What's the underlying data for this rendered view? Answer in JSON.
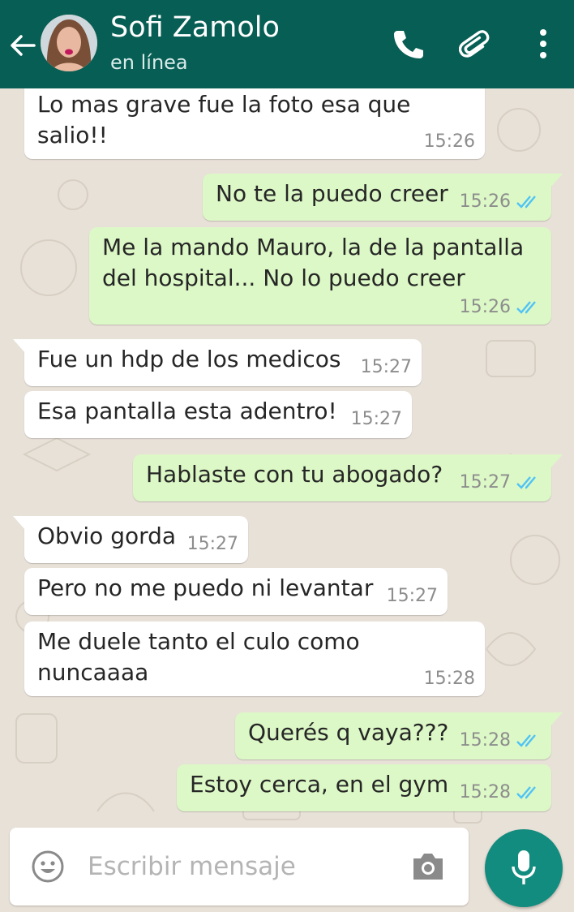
{
  "header": {
    "contact_name": "Sofi Zamolo",
    "status": "en línea",
    "icons": {
      "back": "back-arrow-icon",
      "call": "phone-icon",
      "attach": "paperclip-icon",
      "menu": "more-vert-icon"
    }
  },
  "messages": [
    {
      "dir": "in",
      "lines": [
        "Lo mas grave fue la foto esa que",
        "salio!!"
      ],
      "time": "15:26"
    },
    {
      "dir": "out",
      "lines": [
        "No te la puedo creer"
      ],
      "time": "15:26",
      "read": true
    },
    {
      "dir": "out",
      "lines": [
        "Me la mando Mauro, la de la pantalla",
        "del hospital... No lo puedo creer"
      ],
      "time": "15:26",
      "read": true
    },
    {
      "dir": "in",
      "lines": [
        "Fue un hdp de los medicos"
      ],
      "time": "15:27"
    },
    {
      "dir": "in",
      "lines": [
        "Esa pantalla esta adentro!"
      ],
      "time": "15:27"
    },
    {
      "dir": "out",
      "lines": [
        "Hablaste con tu abogado?"
      ],
      "time": "15:27",
      "read": true
    },
    {
      "dir": "in",
      "lines": [
        "Obvio gorda"
      ],
      "time": "15:27"
    },
    {
      "dir": "in",
      "lines": [
        "Pero no me puedo ni levantar"
      ],
      "time": "15:27"
    },
    {
      "dir": "in",
      "lines": [
        "Me duele tanto el culo como",
        "nuncaaaa"
      ],
      "time": "15:28"
    },
    {
      "dir": "out",
      "lines": [
        "Querés q vaya???"
      ],
      "time": "15:28",
      "read": true
    },
    {
      "dir": "out",
      "lines": [
        "Estoy cerca, en el gym"
      ],
      "time": "15:28",
      "read": true
    }
  ],
  "composer": {
    "placeholder": "Escribir mensaje",
    "icons": {
      "emoji": "emoji-icon",
      "camera": "camera-icon",
      "mic": "microphone-icon"
    }
  },
  "colors": {
    "header": "#075e54",
    "outgoing_bubble": "#dcf8c6",
    "incoming_bubble": "#ffffff",
    "read_ticks": "#4fc3f7",
    "mic_button": "#128c7e",
    "wallpaper": "#e8e1d8"
  }
}
